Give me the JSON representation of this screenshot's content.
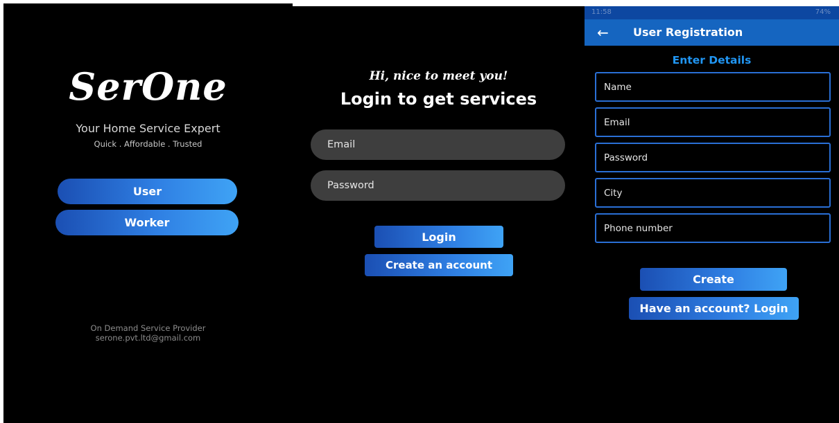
{
  "splash": {
    "logo": "SerOne",
    "tagline": "Your Home Service Expert",
    "subtagline": "Quick . Affordable . Trusted",
    "user_button": "User",
    "worker_button": "Worker",
    "footer_line1": "On Demand Service Provider",
    "footer_line2": "serone.pvt.ltd@gmail.com"
  },
  "login": {
    "greeting": "Hi, nice to meet you!",
    "title": "Login to get services",
    "email_placeholder": "Email",
    "password_placeholder": "Password",
    "login_button": "Login",
    "create_account_button": "Create an account"
  },
  "registration": {
    "status_time": "11:58",
    "status_battery": "74%",
    "appbar_title": "User Registration",
    "section_title": "Enter Details",
    "fields": [
      "Name",
      "Email",
      "Password",
      "City",
      "Phone number"
    ],
    "create_button": "Create",
    "have_account_button": "Have an account? Login"
  },
  "colors": {
    "background": "#000000",
    "accent_blue": "#2196f3",
    "appbar": "#1565c0",
    "field_dark": "#3e3e3e"
  }
}
